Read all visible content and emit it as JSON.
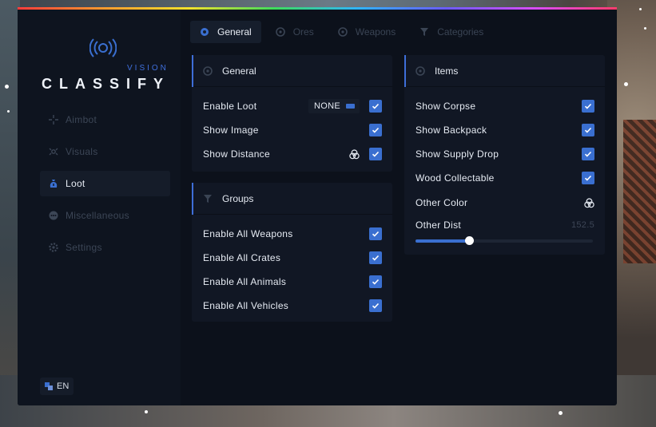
{
  "logo": {
    "sub": "VISION",
    "name": "CLASSIFY"
  },
  "nav": [
    {
      "label": "Aimbot",
      "icon": "crosshair-icon",
      "active": false
    },
    {
      "label": "Visuals",
      "icon": "eye-icon",
      "active": false
    },
    {
      "label": "Loot",
      "icon": "bag-icon",
      "active": true
    },
    {
      "label": "Miscellaneous",
      "icon": "dots-icon",
      "active": false
    },
    {
      "label": "Settings",
      "icon": "gear-icon",
      "active": false
    }
  ],
  "language": "EN",
  "tabs": [
    {
      "label": "General",
      "active": true
    },
    {
      "label": "Ores",
      "active": false
    },
    {
      "label": "Weapons",
      "active": false
    },
    {
      "label": "Categories",
      "active": false
    }
  ],
  "general_panel": {
    "title": "General",
    "enable_loot": {
      "label": "Enable Loot",
      "keybind": "NONE",
      "checked": true
    },
    "show_image": {
      "label": "Show Image",
      "checked": true
    },
    "show_distance": {
      "label": "Show Distance",
      "checked": true
    }
  },
  "groups_panel": {
    "title": "Groups",
    "items": [
      {
        "label": "Enable All Weapons",
        "checked": true
      },
      {
        "label": "Enable All Crates",
        "checked": true
      },
      {
        "label": "Enable All Animals",
        "checked": true
      },
      {
        "label": "Enable All Vehicles",
        "checked": true
      }
    ]
  },
  "items_panel": {
    "title": "Items",
    "items": [
      {
        "label": "Show Corpse",
        "checked": true
      },
      {
        "label": "Show Backpack",
        "checked": true
      },
      {
        "label": "Show Supply Drop",
        "checked": true
      },
      {
        "label": "Wood Collectable",
        "checked": true
      }
    ],
    "other_color": {
      "label": "Other Color"
    },
    "other_dist": {
      "label": "Other Dist",
      "value": "152.5",
      "fill_fraction": 0.3
    }
  },
  "colors": {
    "accent": "#3a6fd0",
    "window_bg": "#0c111b",
    "panel_bg": "#111724"
  }
}
